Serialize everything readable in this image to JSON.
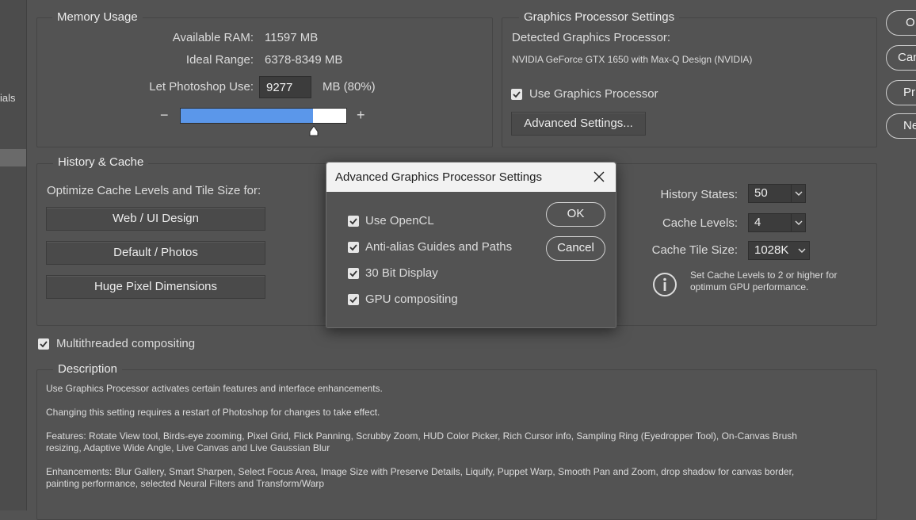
{
  "sidebar": {
    "partial_label": "ials"
  },
  "memory": {
    "title": "Memory Usage",
    "available_label": "Available RAM:",
    "available_value": "11597 MB",
    "ideal_label": "Ideal Range:",
    "ideal_value": "6378-8349 MB",
    "use_label": "Let Photoshop Use:",
    "use_value": "9277",
    "use_suffix": "MB (80%)",
    "minus": "−",
    "plus": "+",
    "slider_fraction": 0.8
  },
  "gpu": {
    "title": "Graphics Processor Settings",
    "detected_label": "Detected Graphics Processor:",
    "detected_value": "NVIDIA GeForce GTX 1650 with Max-Q Design (NVIDIA)",
    "use_gpu_label": "Use Graphics Processor",
    "use_gpu_checked": true,
    "advanced_button": "Advanced Settings..."
  },
  "history": {
    "title": "History & Cache",
    "optimize_label": "Optimize Cache Levels and Tile Size for:",
    "btn_web": "Web / UI Design",
    "btn_default": "Default / Photos",
    "btn_huge": "Huge Pixel Dimensions",
    "states_label": "History States:",
    "states_value": "50",
    "levels_label": "Cache Levels:",
    "levels_value": "4",
    "tile_label": "Cache Tile Size:",
    "tile_value": "1028K",
    "info_text_1": "Set Cache Levels to 2 or higher for",
    "info_text_2": "optimum GPU performance."
  },
  "multithreaded": {
    "label": "Multithreaded compositing",
    "checked": true
  },
  "description": {
    "title": "Description",
    "p1": "Use Graphics Processor activates certain features and interface enhancements.",
    "p2": "Changing this setting requires a restart of Photoshop for changes to take effect.",
    "p3a": "Features: Rotate View tool, Birds-eye zooming, Pixel Grid, Flick Panning, Scrubby Zoom, HUD Color Picker, Rich Cursor info, Sampling Ring (Eyedropper Tool), On-Canvas Brush",
    "p3b": "resizing, Adaptive Wide Angle, Live Canvas and Live Gaussian Blur",
    "p4a": "Enhancements: Blur Gallery, Smart Sharpen, Select Focus Area, Image Size with Preserve Details, Liquify, Puppet Warp, Smooth Pan and Zoom, drop shadow for canvas border,",
    "p4b": "painting performance, selected Neural Filters and Transform/Warp"
  },
  "right_buttons": [
    "O",
    "Can",
    "Pr",
    "Ne"
  ],
  "dialog": {
    "title": "Advanced Graphics Processor Settings",
    "options": [
      {
        "label": "Use OpenCL",
        "checked": true
      },
      {
        "label": "Anti-alias Guides and Paths",
        "checked": true
      },
      {
        "label": "30 Bit Display",
        "checked": true
      },
      {
        "label": "GPU compositing",
        "checked": true
      }
    ],
    "ok": "OK",
    "cancel": "Cancel"
  },
  "colors": {
    "background": "#535353",
    "slider_fill": "#5b97ea",
    "dialog_header": "#f2f2f2"
  }
}
